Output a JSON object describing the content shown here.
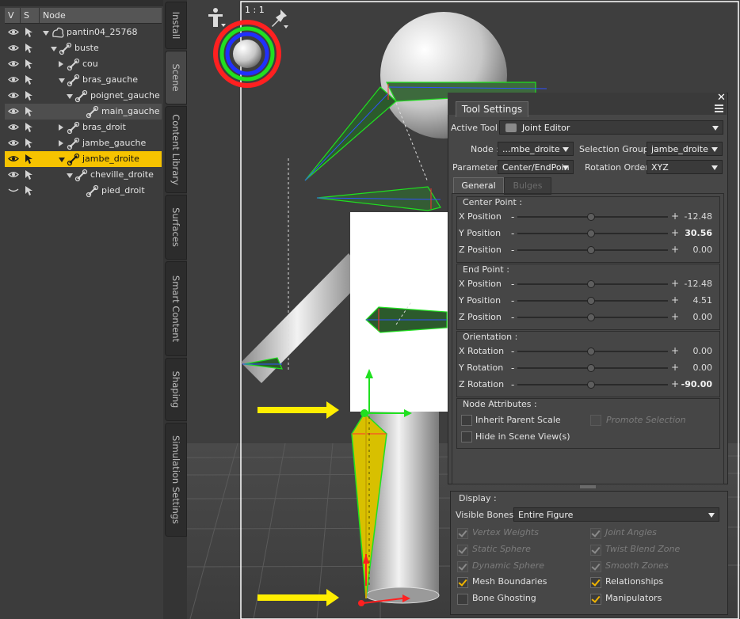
{
  "scene": {
    "columns": {
      "v": "V",
      "s": "S",
      "node": "Node"
    },
    "nodes": [
      {
        "label": "pantin04_25768",
        "level": 0,
        "twisty": "down",
        "icon": "figure-icon",
        "state": "normal"
      },
      {
        "label": "buste",
        "level": 1,
        "twisty": "down",
        "icon": "bone-icon",
        "state": "normal"
      },
      {
        "label": "cou",
        "level": 2,
        "twisty": "right",
        "icon": "bone-icon",
        "state": "normal"
      },
      {
        "label": "bras_gauche",
        "level": 2,
        "twisty": "down",
        "icon": "bone-icon",
        "state": "normal"
      },
      {
        "label": "poignet_gauche",
        "level": 3,
        "twisty": "down",
        "icon": "bone-icon",
        "state": "normal"
      },
      {
        "label": "main_gauche",
        "level": 4,
        "twisty": "none",
        "icon": "bone-icon",
        "state": "highlight"
      },
      {
        "label": "bras_droit",
        "level": 2,
        "twisty": "right",
        "icon": "bone-icon",
        "state": "normal"
      },
      {
        "label": "jambe_gauche",
        "level": 2,
        "twisty": "right",
        "icon": "bone-icon",
        "state": "normal"
      },
      {
        "label": "jambe_droite",
        "level": 2,
        "twisty": "down",
        "icon": "bone-icon",
        "state": "selected"
      },
      {
        "label": "cheville_droite",
        "level": 3,
        "twisty": "down",
        "icon": "bone-icon",
        "state": "normal"
      },
      {
        "label": "pied_droit",
        "level": 4,
        "twisty": "none",
        "icon": "bone-icon",
        "state": "normal"
      }
    ]
  },
  "side_tabs": [
    "Install",
    "Scene",
    "Content Library",
    "Surfaces",
    "Smart Content",
    "Shaping",
    "Simulation Settings"
  ],
  "viewport": {
    "zoom_label": "1 : 1"
  },
  "tool_settings": {
    "title": "Tool Settings",
    "active_tool_label": "Active Tool :",
    "active_tool_value": "Joint Editor",
    "node_label": "Node :",
    "node_value": "...mbe_droite",
    "selection_group_label": "Selection Group :",
    "selection_group_value": "jambe_droite",
    "parameter_label": "Parameter :",
    "parameter_value": "Center/EndPoin",
    "rotation_order_label": "Rotation Order :",
    "rotation_order_value": "XYZ",
    "tabs": [
      "General",
      "Bulges"
    ],
    "center_point": {
      "title": "Center Point :",
      "rows": [
        {
          "label": "X Position",
          "value": "-12.48",
          "bold": false
        },
        {
          "label": "Y Position",
          "value": "30.56",
          "bold": true
        },
        {
          "label": "Z Position",
          "value": "0.00",
          "bold": false
        }
      ]
    },
    "end_point": {
      "title": "End Point :",
      "rows": [
        {
          "label": "X Position",
          "value": "-12.48",
          "bold": false
        },
        {
          "label": "Y Position",
          "value": "4.51",
          "bold": false
        },
        {
          "label": "Z Position",
          "value": "0.00",
          "bold": false
        }
      ]
    },
    "orientation": {
      "title": "Orientation :",
      "rows": [
        {
          "label": "X Rotation",
          "value": "0.00",
          "bold": false
        },
        {
          "label": "Y Rotation",
          "value": "0.00",
          "bold": false
        },
        {
          "label": "Z Rotation",
          "value": "-90.00",
          "bold": true
        }
      ]
    },
    "node_attributes": {
      "title": "Node Attributes :",
      "inherit_parent_scale": "Inherit Parent Scale",
      "promote_selection": "Promote Selection",
      "hide_in_scene_view": "Hide in Scene View(s)"
    },
    "display": {
      "title": "Display :",
      "visible_bones_label": "Visible Bones :",
      "visible_bones_value": "Entire Figure",
      "options": {
        "vertex_weights": {
          "label": "Vertex Weights",
          "checked": true,
          "enabled": false
        },
        "joint_angles": {
          "label": "Joint Angles",
          "checked": true,
          "enabled": false
        },
        "static_sphere": {
          "label": "Static Sphere",
          "checked": true,
          "enabled": false
        },
        "twist_blend_zone": {
          "label": "Twist Blend Zone",
          "checked": true,
          "enabled": false
        },
        "dynamic_sphere": {
          "label": "Dynamic Sphere",
          "checked": true,
          "enabled": false
        },
        "smooth_zones": {
          "label": "Smooth Zones",
          "checked": true,
          "enabled": false
        },
        "mesh_boundaries": {
          "label": "Mesh Boundaries",
          "checked": true,
          "enabled": true
        },
        "relationships": {
          "label": "Relationships",
          "checked": true,
          "enabled": true
        },
        "bone_ghosting": {
          "label": "Bone Ghosting",
          "checked": false,
          "enabled": true
        },
        "manipulators": {
          "label": "Manipulators",
          "checked": true,
          "enabled": true
        }
      }
    }
  },
  "colors": {
    "selection": "#f6c300",
    "annotation_arrow": "#ffee00",
    "gizmo_x": "#ff2020",
    "gizmo_y": "#20e020"
  }
}
